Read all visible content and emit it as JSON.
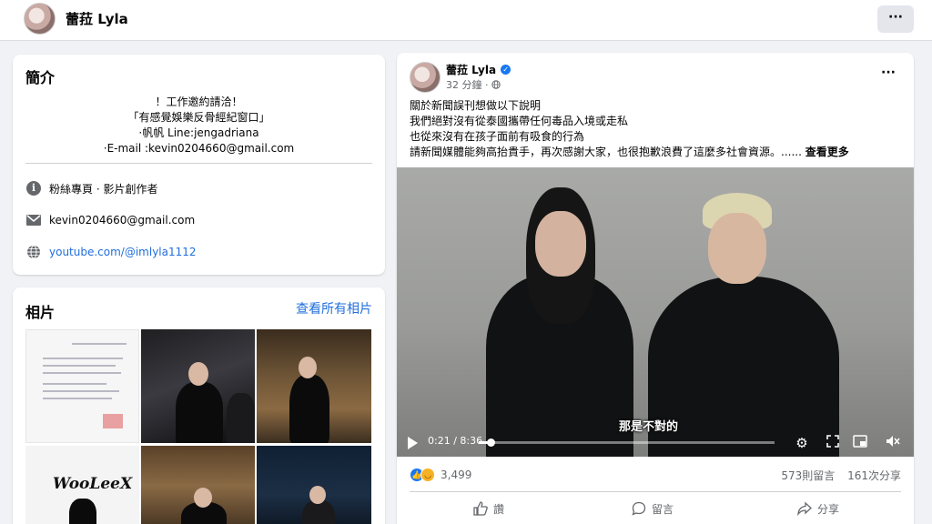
{
  "header": {
    "name": "蕾菈 Lyla",
    "more_label": "···"
  },
  "intro": {
    "title": "簡介",
    "bio": [
      "！工作邀約請洽！",
      "「有感覺娛樂反骨經紀窗口」",
      "·帆帆 Line:jengadriana",
      "·E-mail :kevin0204660@gmail.com"
    ],
    "category": "粉絲專頁 · 影片創作者",
    "email": "kevin0204660@gmail.com",
    "website": "youtube.com/@imlyla1112"
  },
  "photos": {
    "title": "相片",
    "see_all": "查看所有相片",
    "logo_text": "WooLeeX"
  },
  "post": {
    "author": "蕾菈 Lyla",
    "time": "32 分鐘 ·",
    "more_label": "···",
    "lines": [
      "關於新聞誤刊想做以下說明",
      "我們絕對沒有從泰國攜帶任何毒品入境或走私",
      "也從來沒有在孩子面前有吸食的行為",
      "請新聞媒體能夠高抬貴手，再次感謝大家，也很抱歉浪費了這麼多社會資源。...... "
    ],
    "see_more": "查看更多",
    "video": {
      "subtitle": "那是不對的",
      "time": "0:21 / 8:36",
      "progress": 0.04
    },
    "reaction_count": "3,499",
    "comments": "573則留言",
    "shares": "161次分享",
    "actions": {
      "like": "讚",
      "comment": "留言",
      "share": "分享"
    }
  },
  "colors": {
    "accent": "#1877f2",
    "link": "#216fdb",
    "page_bg": "#f0f2f5"
  }
}
